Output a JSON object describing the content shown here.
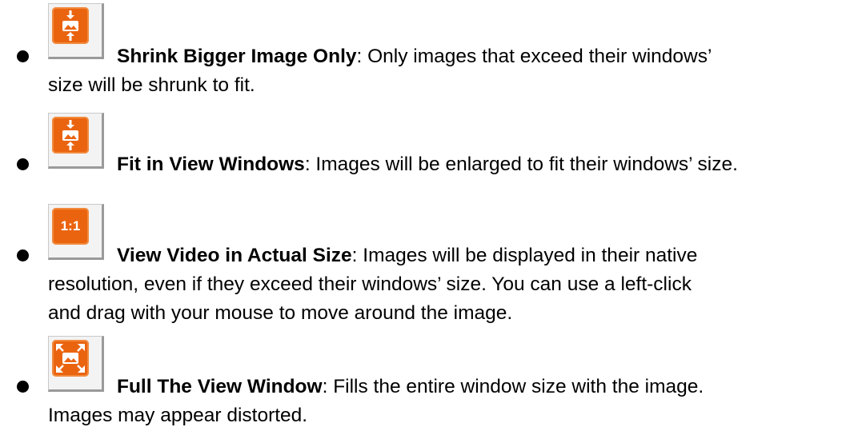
{
  "items": [
    {
      "icon": "shrink-bigger-image-icon",
      "title": "Shrink Bigger Image Only",
      "desc_line1": ": Only images that exceed their windows’",
      "desc_line2": "size will be shrunk to fit."
    },
    {
      "icon": "fit-in-view-windows-icon",
      "title": "Fit in View Windows",
      "desc_line1": ": Images will be enlarged to fit their windows’ size."
    },
    {
      "icon": "actual-size-icon",
      "icon_text": "1:1",
      "title": "View Video in Actual Size",
      "desc_line1": ": Images will be displayed in their native",
      "desc_line2": "resolution, even if they exceed their windows’ size. You can use a left-click",
      "desc_line3": "and drag with your mouse to move around the image."
    },
    {
      "icon": "full-view-window-icon",
      "title": "Full The View Window",
      "desc_line1": ": Fills the entire window size with the image.",
      "desc_line2": "Images may appear distorted."
    }
  ],
  "colors": {
    "icon_orange": "#ea6410",
    "text": "#000000"
  }
}
